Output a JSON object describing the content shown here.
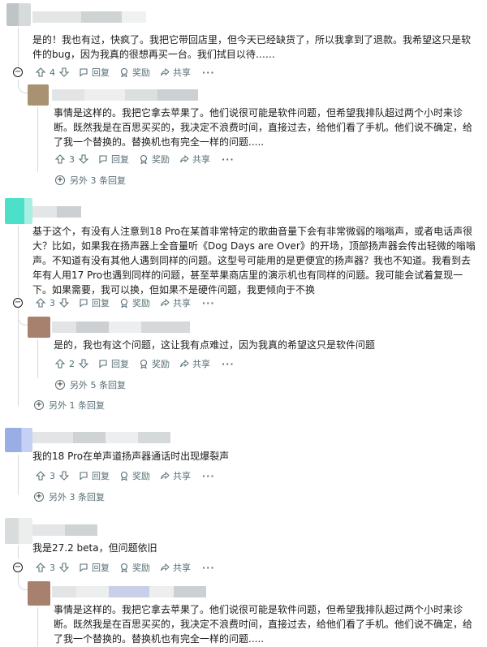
{
  "labels": {
    "reply": "回复",
    "award": "奖励",
    "share": "共享",
    "more": "···"
  },
  "colors": {
    "text": "#1a1a1b",
    "meta": "#576f76",
    "thread_line": "#d9d9d9"
  },
  "comments": [
    {
      "id": "c1",
      "body": "是的！我也有过，快疯了。我把它带回店里，但今天已经缺货了，所以我拿到了退款。我希望这只是软件的bug，因为我真的很想再买一台。我们拭目以待……",
      "votes": "4"
    },
    {
      "id": "c1r1",
      "body": "事情是这样的。我把它拿去苹果了。他们说很可能是软件问题，但希望我排队超过两个小时来诊断。既然我是在百思买买的，我决定不浪费时间，直接过去，给他们看了手机。他们说不确定，给了我一个替换的。替换机也有完全一样的问题.....",
      "votes": "3",
      "more_replies": "另外 3 条回复"
    },
    {
      "id": "c2",
      "body": "基于这个，有没有人注意到18 Pro在某首非常特定的歌曲音量下会有非常微弱的嗡嗡声，或者电话声很大？比如，如果我在扬声器上全音量听《Dog Days are Over》的开场，顶部扬声器会传出轻微的嗡嗡声。不知道有没有其他人遇到同样的问题。这型号可能用的是更便宜的扬声器？我也不知道。我看到去年有人用17 Pro也遇到同样的问题，甚至苹果商店里的演示机也有同样的问题。我可能会试着复现一下。如果需要，我可以换，但如果不是硬件问题，我更倾向于不换",
      "votes": "3",
      "more_replies": "另外 1 条回复"
    },
    {
      "id": "c2r1",
      "body": "是的，我也有这个问题，这让我有点难过，因为我真的希望这只是软件问题",
      "votes": "2",
      "more_replies": "另外 5 条回复"
    },
    {
      "id": "c3",
      "body": "我的18 Pro在单声道扬声器通话时出现爆裂声",
      "votes": "3",
      "more_replies": "另外 3 条回复"
    },
    {
      "id": "c4",
      "body": "我是27.2 beta，但问题依旧",
      "votes": "3"
    },
    {
      "id": "c4r1",
      "body": "事情是这样的。我把它拿去苹果了。他们说很可能是软件问题，但希望我排队超过两个小时来诊断。既然我是在百思买买的，我决定不浪费时间，直接过去，给他们看了手机。他们说不确定，给了我一个替换的。替换机也有完全一样的问题....."
    }
  ]
}
